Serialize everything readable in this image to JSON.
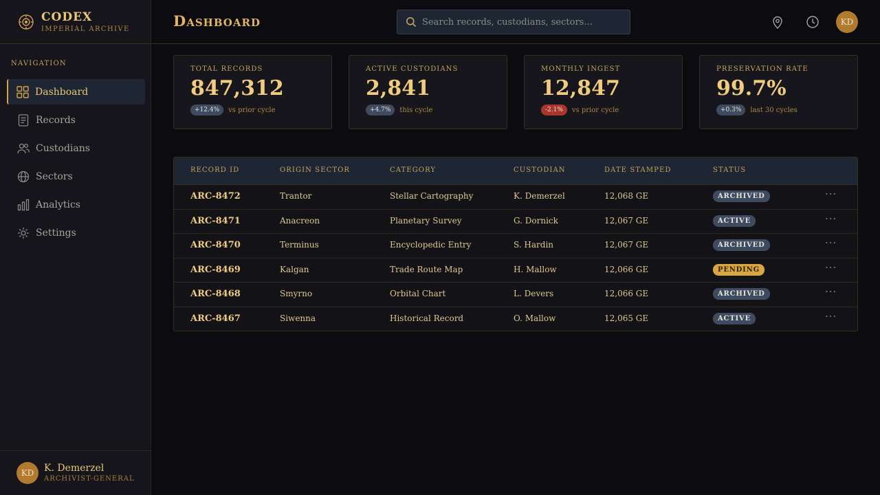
{
  "brand": {
    "title": "CODEX",
    "subtitle": "IMPERIAL ARCHIVE"
  },
  "nav": {
    "heading": "NAVIGATION",
    "items": [
      {
        "label": "Dashboard",
        "icon": "grid-icon",
        "active": true
      },
      {
        "label": "Records",
        "icon": "document-icon"
      },
      {
        "label": "Custodians",
        "icon": "users-icon"
      },
      {
        "label": "Sectors",
        "icon": "globe-icon"
      },
      {
        "label": "Analytics",
        "icon": "bar-chart-icon"
      },
      {
        "label": "Settings",
        "icon": "gear-icon"
      }
    ]
  },
  "user": {
    "initials": "KD",
    "name": "K. Demerzel",
    "role": "ARCHIVIST-GENERAL"
  },
  "header": {
    "title": "Dashboard",
    "search_placeholder": "Search records, custodians, sectors...",
    "avatar_initials": "KD"
  },
  "stats": [
    {
      "label": "TOTAL RECORDS",
      "value": "847,312",
      "change": "+12.4%",
      "note": "vs prior cycle",
      "trend": "up"
    },
    {
      "label": "ACTIVE CUSTODIANS",
      "value": "2,841",
      "change": "+4.7%",
      "note": "this cycle",
      "trend": "up"
    },
    {
      "label": "MONTHLY INGEST",
      "value": "12,847",
      "change": "-2.1%",
      "note": "vs prior cycle",
      "trend": "down"
    },
    {
      "label": "PRESERVATION RATE",
      "value": "99.7%",
      "change": "+0.3%",
      "note": "last 30 cycles",
      "trend": "up"
    }
  ],
  "table": {
    "columns": [
      "RECORD ID",
      "ORIGIN SECTOR",
      "CATEGORY",
      "CUSTODIAN",
      "DATE STAMPED",
      "STATUS"
    ],
    "rows": [
      {
        "id": "ARC-8472",
        "sector": "Trantor",
        "category": "Stellar Cartography",
        "custodian": "K. Demerzel",
        "date": "12,068 GE",
        "status": "ARCHIVED"
      },
      {
        "id": "ARC-8471",
        "sector": "Anacreon",
        "category": "Planetary Survey",
        "custodian": "G. Dornick",
        "date": "12,067 GE",
        "status": "ACTIVE"
      },
      {
        "id": "ARC-8470",
        "sector": "Terminus",
        "category": "Encyclopedic Entry",
        "custodian": "S. Hardin",
        "date": "12,067 GE",
        "status": "ARCHIVED"
      },
      {
        "id": "ARC-8469",
        "sector": "Kalgan",
        "category": "Trade Route Map",
        "custodian": "H. Mallow",
        "date": "12,066 GE",
        "status": "PENDING"
      },
      {
        "id": "ARC-8468",
        "sector": "Smyrno",
        "category": "Orbital Chart",
        "custodian": "L. Devers",
        "date": "12,066 GE",
        "status": "ARCHIVED"
      },
      {
        "id": "ARC-8467",
        "sector": "Siwenna",
        "category": "Historical Record",
        "custodian": "O. Mallow",
        "date": "12,065 GE",
        "status": "ACTIVE"
      }
    ],
    "row_action": "···"
  },
  "colors": {
    "accent": "#e8c77a",
    "background": "#0c0c10",
    "panel": "#16161c",
    "badge_default": "#3e4a5f",
    "badge_pending": "#d9a642",
    "chip_negative": "#a8362d"
  }
}
